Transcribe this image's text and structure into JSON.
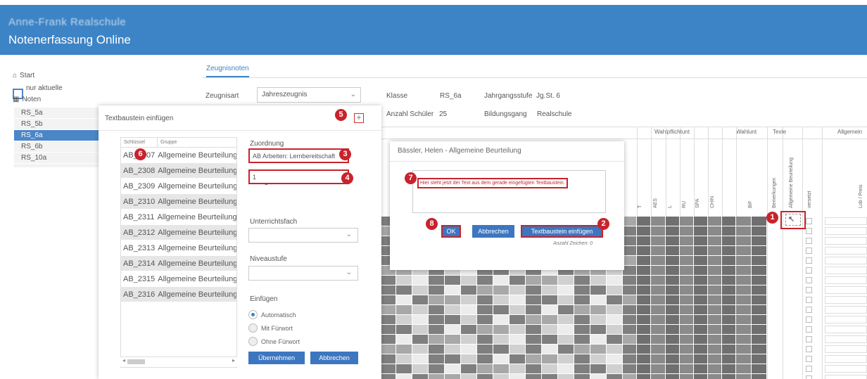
{
  "header": {
    "school": "Anne-Frank Realschule",
    "title": "Notenerfassung Online"
  },
  "sidebar": {
    "start": "Start",
    "only_current": "nur aktuelle",
    "noten": "Noten",
    "classes": [
      "RS_5a",
      "RS_5b",
      "RS_6a",
      "RS_6b",
      "RS_10a"
    ],
    "active_class": "RS_6a"
  },
  "tabs": {
    "zeugnisnoten": "Zeugnisnoten"
  },
  "filters": {
    "zeugnisart_label": "Zeugnisart",
    "zeugnisart_value": "Jahreszeugnis",
    "klasse_label": "Klasse",
    "klasse_value": "RS_6a",
    "jahrgangsstufe_label": "Jahrgangsstufe",
    "jahrgangsstufe_value": "Jg.St. 6",
    "anzahl_label": "Anzahl Schüler",
    "anzahl_value": "25",
    "bildungsgang_label": "Bildungsgang",
    "bildungsgang_value": "Realschule"
  },
  "grid": {
    "groups": [
      "Wahlpflichtunt",
      "Wahlunt",
      "Texte",
      "Allgemein"
    ],
    "columns": [
      "T",
      "AES",
      "L",
      "RU",
      "SPA",
      "CHIN",
      "BiF",
      "Bemerkungen",
      "Allgemeine Beurteilung",
      "versetzt",
      "Lob / Preis"
    ]
  },
  "textbaustein": {
    "title": "Textbaustein einfügen",
    "plus": "+",
    "col_key": "Schlüssel",
    "col_group": "Gruppe",
    "rows": [
      {
        "key": "AB_2307",
        "group": "Allgemeine Beurteilung"
      },
      {
        "key": "AB_2308",
        "group": "Allgemeine Beurteilung"
      },
      {
        "key": "AB_2309",
        "group": "Allgemeine Beurteilung"
      },
      {
        "key": "AB_2310",
        "group": "Allgemeine Beurteilung"
      },
      {
        "key": "AB_2311",
        "group": "Allgemeine Beurteilung"
      },
      {
        "key": "AB_2312",
        "group": "Allgemeine Beurteilung"
      },
      {
        "key": "AB_2313",
        "group": "Allgemeine Beurteilung"
      },
      {
        "key": "AB_2314",
        "group": "Allgemeine Beurteilung"
      },
      {
        "key": "AB_2315",
        "group": "Allgemeine Beurteilung"
      },
      {
        "key": "AB_2316",
        "group": "Allgemeine Beurteilung"
      }
    ],
    "zuordnung_label": "Zuordnung",
    "zuordnung_value": "AB Arbeiten: Lernbereitschaft",
    "kategorie_label": "Kategorie",
    "kategorie_value": "1",
    "fach_label": "Unterrichtsfach",
    "niveau_label": "Niveaustufe",
    "einfuegen_label": "Einfügen",
    "radio_auto": "Automatisch",
    "radio_mit": "Mit Fürwort",
    "radio_ohne": "Ohne Fürwort",
    "btn_ok": "Übernehmen",
    "btn_cancel": "Abbrechen"
  },
  "modal": {
    "title": "Bässler, Helen - Allgemeine Beurteilung",
    "text": "Hier steht jetzt der Text aus dem gerade eingefügten Textbaustein.",
    "btn_ok": "OK",
    "btn_cancel": "Abbrechen",
    "btn_insert": "Textbaustein einfügen",
    "count": "Anzahl Zeichen:  0"
  },
  "badges": [
    "1",
    "2",
    "3",
    "4",
    "5",
    "6",
    "7",
    "8"
  ],
  "colors": {
    "header": "#3d84c6",
    "accent": "#3d76c0",
    "marker": "#c8232c"
  }
}
